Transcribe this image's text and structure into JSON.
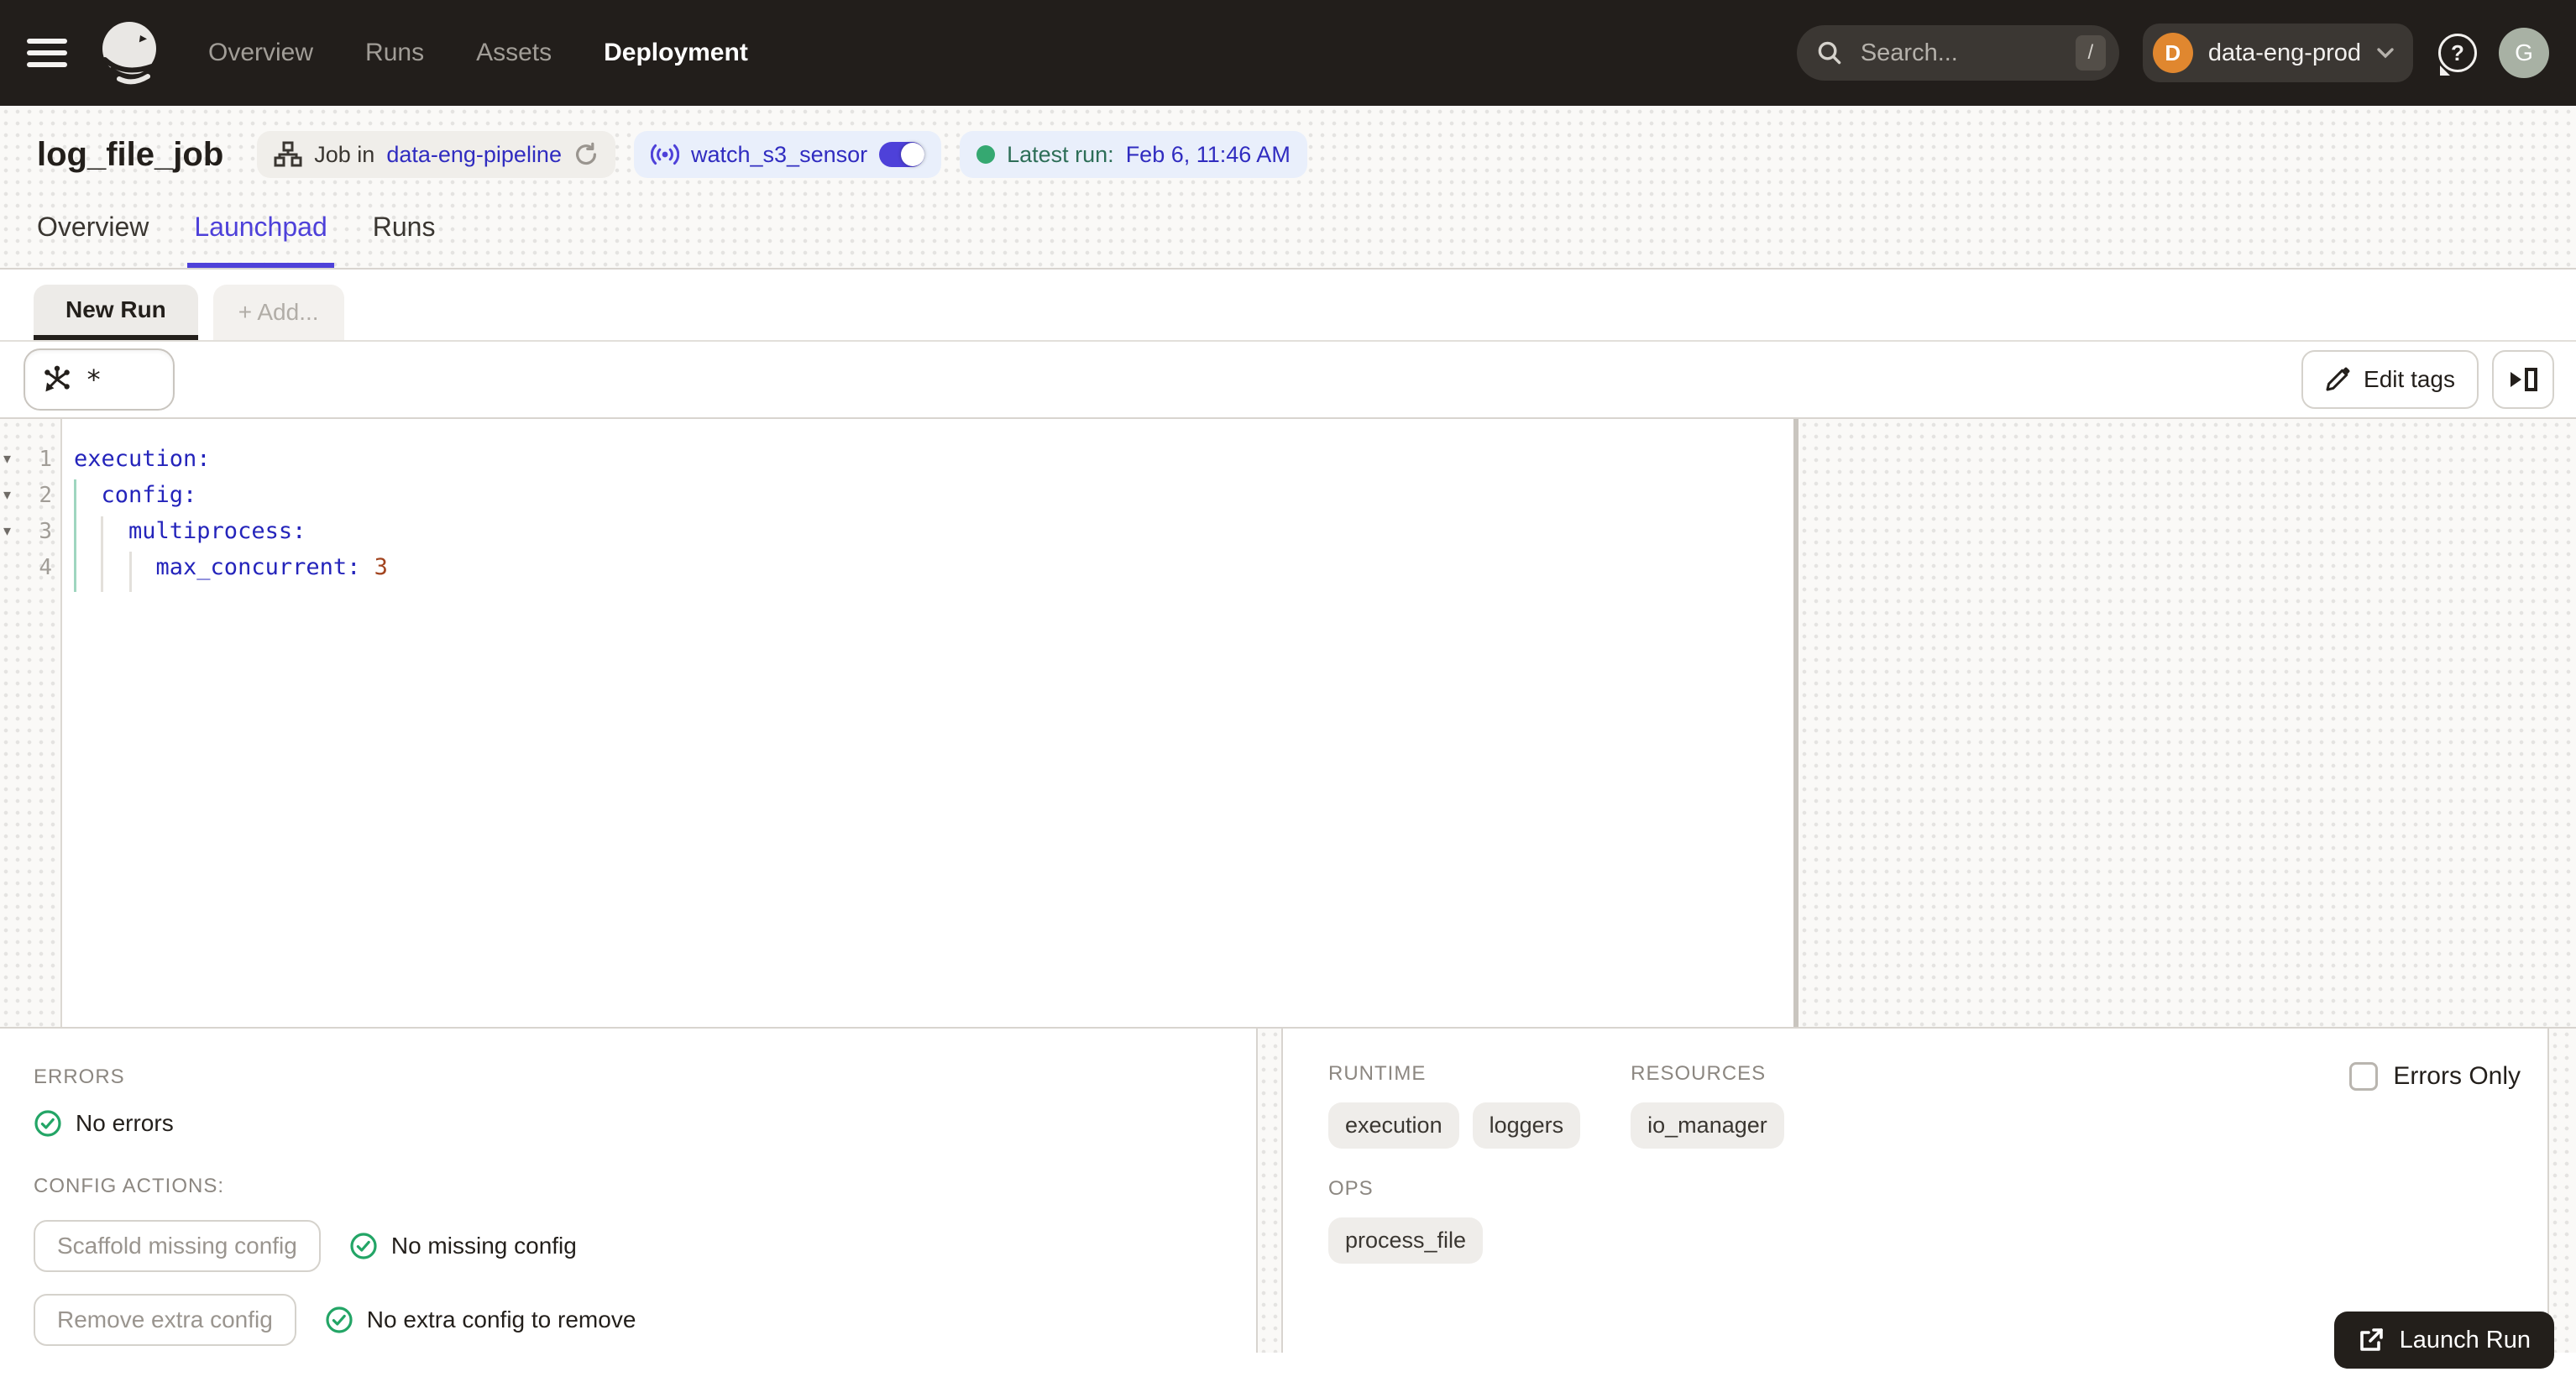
{
  "nav": {
    "items": [
      {
        "label": "Overview"
      },
      {
        "label": "Runs"
      },
      {
        "label": "Assets"
      },
      {
        "label": "Deployment"
      }
    ],
    "search": {
      "placeholder": "Search...",
      "shortcut": "/"
    },
    "workspace": {
      "initial": "D",
      "name": "data-eng-prod"
    },
    "help_glyph": "?",
    "user_initial": "G"
  },
  "header": {
    "title": "log_file_job",
    "job_badge": {
      "prefix": "Job in",
      "link": "data-eng-pipeline"
    },
    "sensor_badge": {
      "name": "watch_s3_sensor"
    },
    "latest_run": {
      "label": "Latest run:",
      "value": "Feb 6, 11:46 AM"
    }
  },
  "tabs": [
    {
      "label": "Overview"
    },
    {
      "label": "Launchpad"
    },
    {
      "label": "Runs"
    }
  ],
  "run_tabs": {
    "current": "New Run",
    "add": "+ Add..."
  },
  "toolbar": {
    "op_selector": "*",
    "edit_tags": "Edit tags"
  },
  "editor": {
    "lines": [
      {
        "num": "1",
        "fold": "▾",
        "key": "execution:"
      },
      {
        "num": "2",
        "fold": "▾",
        "key": "  config:"
      },
      {
        "num": "3",
        "fold": "▾",
        "key": "    multiprocess:"
      },
      {
        "num": "4",
        "fold": "",
        "key": "      max_concurrent: ",
        "value": "3"
      }
    ]
  },
  "errors_panel": {
    "header": "ERRORS",
    "no_errors": "No errors",
    "actions_header": "CONFIG ACTIONS:",
    "actions": [
      {
        "button": "Scaffold missing config",
        "status": "No missing config"
      },
      {
        "button": "Remove extra config",
        "status": "No extra config to remove"
      }
    ]
  },
  "target_panel": {
    "errors_only": "Errors Only",
    "sections": [
      {
        "header": "RUNTIME",
        "tags": [
          "execution",
          "loggers"
        ]
      },
      {
        "header": "RESOURCES",
        "tags": [
          "io_manager"
        ]
      },
      {
        "header": "OPS",
        "tags": [
          "process_file"
        ]
      }
    ]
  },
  "launch_label": "Launch Run",
  "colors": {
    "accent": "#4e41d9",
    "link": "#302cc0",
    "success_green": "#23a566",
    "run_dot_green": "#35a871",
    "nav_bg": "#221e1b",
    "yaml_key": "#2424bb",
    "yaml_number": "#a2441f"
  }
}
